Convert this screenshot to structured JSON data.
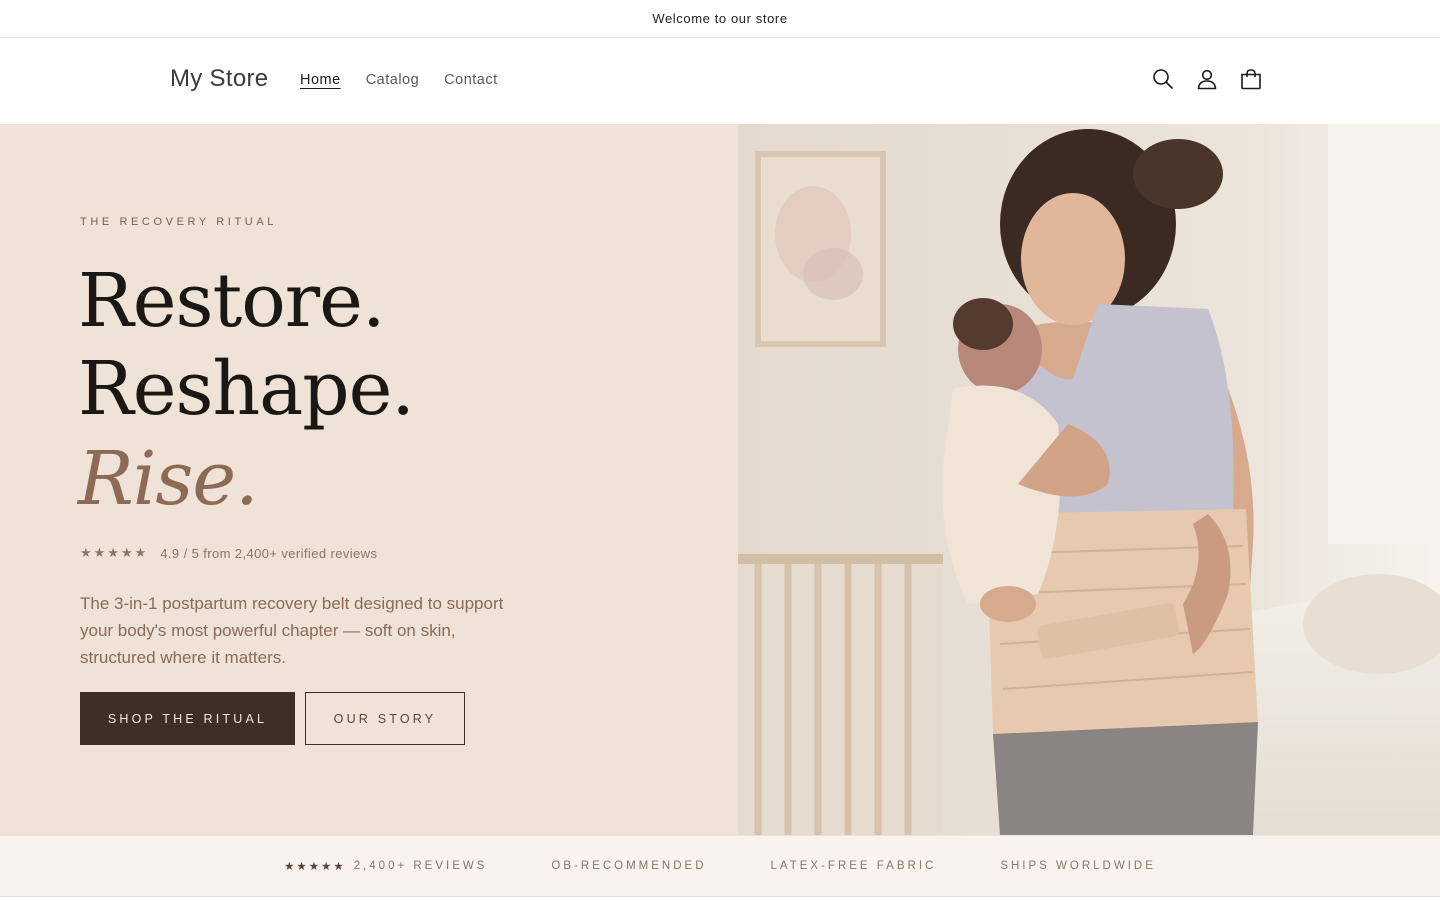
{
  "announcement": {
    "text": "Welcome to our store"
  },
  "header": {
    "logo": "My Store",
    "nav": [
      {
        "label": "Home",
        "active": true
      },
      {
        "label": "Catalog",
        "active": false
      },
      {
        "label": "Contact",
        "active": false
      }
    ],
    "icons": [
      "search-icon",
      "account-icon",
      "cart-icon"
    ]
  },
  "hero": {
    "eyebrow": "THE RECOVERY RITUAL",
    "headline": [
      "Restore.",
      "Reshape.",
      "Rise."
    ],
    "rating": {
      "stars": "★★★★★",
      "text": "4.9 / 5 from 2,400+ verified reviews"
    },
    "description": "The 3-in-1 postpartum recovery belt designed to support your body's most powerful chapter — soft on skin, structured where it matters.",
    "primary_button": "SHOP THE RITUAL",
    "secondary_button": "OUR STORY",
    "image_alt": "Mother holding newborn wearing postpartum recovery belt"
  },
  "trust_bar": {
    "items": [
      {
        "stars": "★★★★★",
        "text": "2,400+ REVIEWS"
      },
      {
        "stars": "",
        "text": "OB-RECOMMENDED"
      },
      {
        "stars": "",
        "text": "LATEX-FREE FABRIC"
      },
      {
        "stars": "",
        "text": "SHIPS WORLDWIDE"
      }
    ]
  },
  "colors": {
    "hero_bg": "#efe2d6",
    "primary_button": "#3d2e26",
    "accent_text": "#8d6a55",
    "trust_bg": "#f8f3ee"
  }
}
